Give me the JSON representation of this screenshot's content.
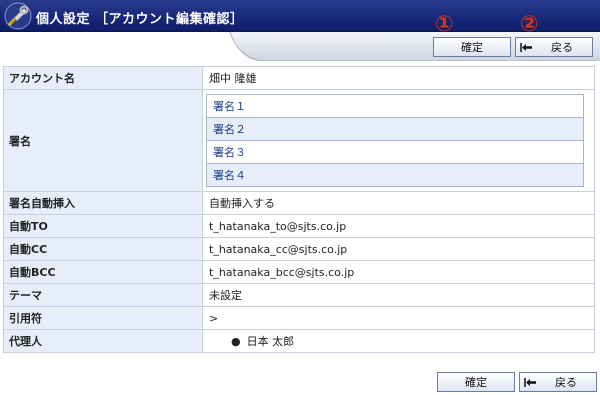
{
  "title": "個人設定 ［アカウント編集確認］",
  "buttons": {
    "confirm": "確定",
    "back": "戻る"
  },
  "markers": {
    "one": "①",
    "two": "②"
  },
  "rows": {
    "account_name": {
      "label": "アカウント名",
      "value": "畑中 隆雄"
    },
    "signature": {
      "label": "署名",
      "items": [
        "署名１",
        "署名２",
        "署名３",
        "署名４"
      ]
    },
    "auto_insert": {
      "label": "署名自動挿入",
      "value": "自動挿入する"
    },
    "auto_to": {
      "label": "自動TO",
      "value": "t_hatanaka_to@sjts.co.jp"
    },
    "auto_cc": {
      "label": "自動CC",
      "value": "t_hatanaka_cc@sjts.co.jp"
    },
    "auto_bcc": {
      "label": "自動BCC",
      "value": "t_hatanaka_bcc@sjts.co.jp"
    },
    "theme": {
      "label": "テーマ",
      "value": "未設定"
    },
    "quote": {
      "label": "引用符",
      "value": ">"
    },
    "proxy": {
      "label": "代理人",
      "value": "日本 太郎"
    }
  },
  "colors": {
    "titlebar": "#162777",
    "label_bg": "#e8eef9",
    "signature_text": "#1a3f8a",
    "marker": "#e03010"
  },
  "icons": {
    "title": "tools-icon",
    "back": "back-arrow-icon",
    "bullet": "bullet-icon"
  }
}
